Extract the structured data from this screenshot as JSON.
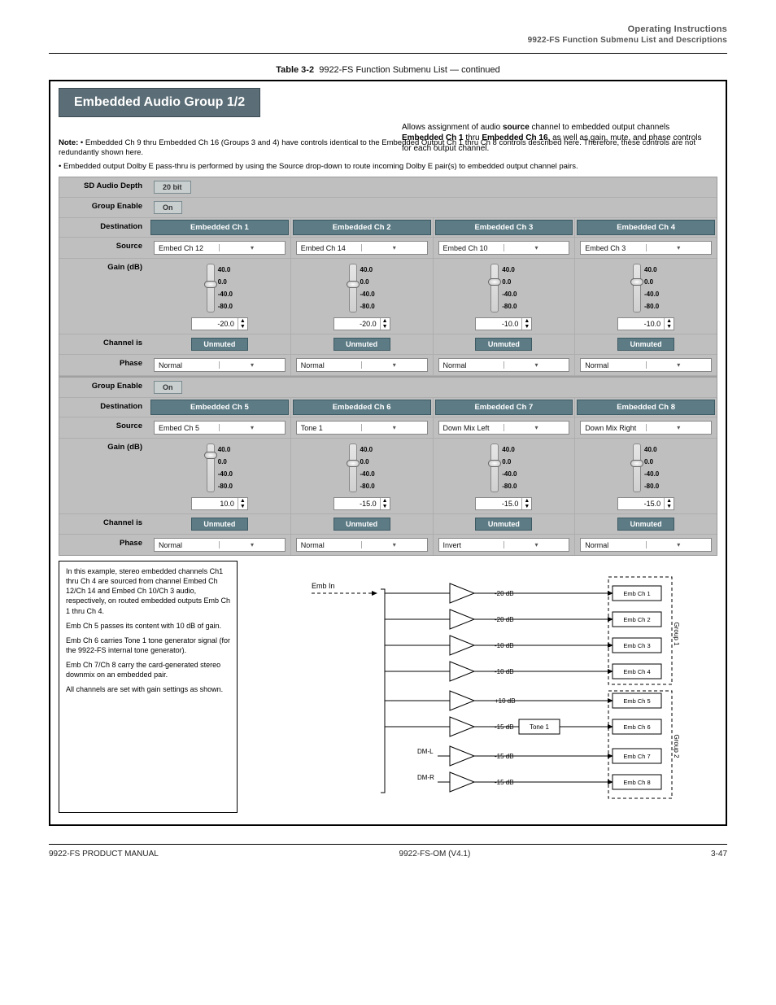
{
  "header": {
    "line1": "Operating Instructions",
    "line2": "9922-FS Function Submenu List and Descriptions"
  },
  "table_caption_prefix": "Table 3-2",
  "table_caption_rest": "9922-FS Function Submenu List — continued",
  "tab_title": "Embedded Audio Group 1/2",
  "right_desc_html": "Allows assignment of audio <b>source</b> channel to embedded output channels <b>Embedded Ch 1</b> thru <b>Embedded Ch 16</b>, as well as gain, mute, and phase controls for each output channel.",
  "notes": [
    {
      "b": "Note:",
      "t": " • Embedded Ch 9 thru Embedded Ch 16 (Groups 3 and 4) have controls identical to the Embedded Output Ch 1 thru Ch 8 controls described here. Therefore, these controls are not redundantly shown here."
    },
    {
      "b": "",
      "t": "• Embedded output Dolby E pass-thru is performed by using the Source drop-down to route incoming Dolby E pair(s) to embedded output channel pairs."
    }
  ],
  "labels": {
    "sd_depth": "SD Audio Depth",
    "group_enable": "Group Enable",
    "destination": "Destination",
    "source": "Source",
    "gain": "Gain (dB)",
    "channel_is": "Channel is",
    "phase": "Phase"
  },
  "sd_depth_val": "20 bit",
  "on_label": "On",
  "ticks": [
    "40.0",
    "0.0",
    "-40.0",
    "-80.0"
  ],
  "unmuted": "Unmuted",
  "groups": [
    {
      "ch": [
        {
          "dest": "Embedded Ch 1",
          "src": "Embed Ch 12",
          "val": "-20.0",
          "thumb_pct": 35,
          "phase": "Normal"
        },
        {
          "dest": "Embedded Ch 2",
          "src": "Embed Ch 14",
          "val": "-20.0",
          "thumb_pct": 35,
          "phase": "Normal"
        },
        {
          "dest": "Embedded Ch 3",
          "src": "Embed Ch 10",
          "val": "-10.0",
          "thumb_pct": 30,
          "phase": "Normal"
        },
        {
          "dest": "Embedded Ch 4",
          "src": "Embed Ch 3",
          "val": "-10.0",
          "thumb_pct": 30,
          "phase": "Normal"
        }
      ]
    },
    {
      "ch": [
        {
          "dest": "Embedded Ch 5",
          "src": "Embed Ch 5",
          "val": "10.0",
          "thumb_pct": 15,
          "phase": "Normal"
        },
        {
          "dest": "Embedded Ch 6",
          "src": "Tone 1",
          "val": "-15.0",
          "thumb_pct": 33,
          "phase": "Normal"
        },
        {
          "dest": "Embedded Ch 7",
          "src": "Down Mix Left",
          "val": "-15.0",
          "thumb_pct": 33,
          "phase": "Invert"
        },
        {
          "dest": "Embedded Ch 8",
          "src": "Down Mix Right",
          "val": "-15.0",
          "thumb_pct": 33,
          "phase": "Normal"
        }
      ]
    }
  ],
  "diag_text": [
    "In this example, stereo embedded channels Ch1 thru Ch 4 are sourced from channel Embed Ch 12/Ch 14 and Embed Ch 10/Ch 3 audio, respectively, on routed embedded outputs Emb Ch 1 thru Ch 4.",
    "Emb Ch 5 passes its content with 10 dB of gain.",
    "Emb Ch 6 carries Tone 1 tone generator signal (for the 9922-FS internal tone generator).",
    "Emb Ch 7/Ch 8 carry the card-generated stereo downmix on an embedded pair.",
    "All channels are set with gain settings as shown."
  ],
  "diag_in_label": "Emb In",
  "diag_outs": [
    "Emb Ch 1",
    "Emb Ch 2",
    "Emb Ch 3",
    "Emb Ch 4",
    "Emb Ch 5",
    "Emb Ch 6",
    "Emb Ch 7",
    "Emb Ch 8"
  ],
  "diag_gains": [
    "-20 dB",
    "-20 dB",
    "-10 dB",
    "-10 dB",
    "+10 dB",
    "-15 dB",
    "-15 dB",
    "-15 dB"
  ],
  "diag_tone": "Tone 1",
  "diag_dm": [
    "DM-L",
    "DM-R"
  ],
  "diag_group1": "Group 1",
  "diag_group2": "Group 2",
  "footer": {
    "left": "9922-FS PRODUCT MANUAL",
    "mid": "9922-FS-OM (V4.1)",
    "right": "3-47"
  }
}
